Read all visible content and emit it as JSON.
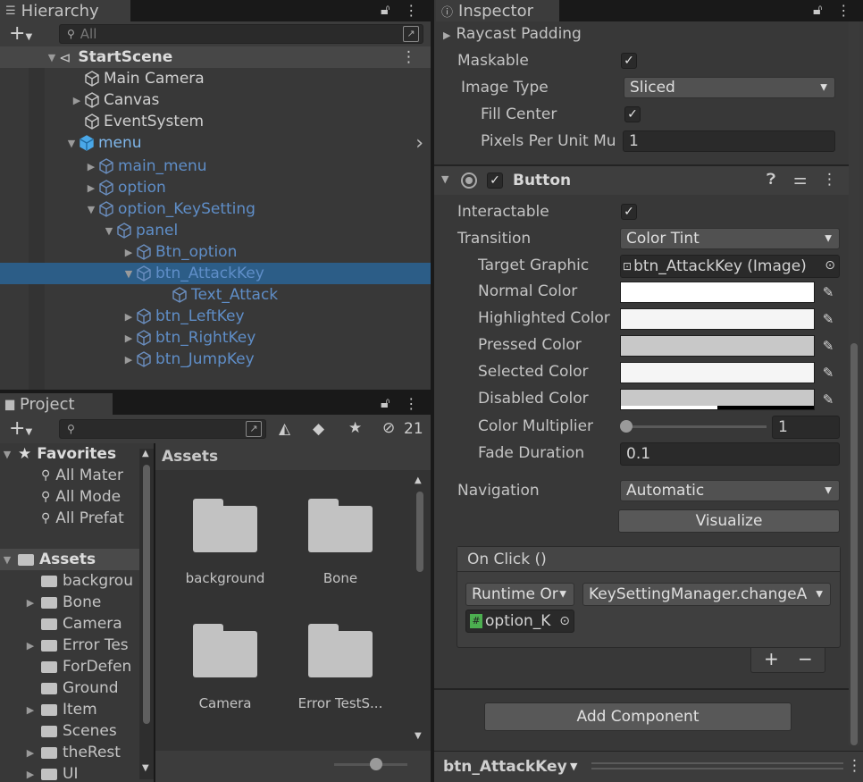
{
  "hierarchy": {
    "tab_label": "Hierarchy",
    "search_placeholder": "All",
    "scene_name": "StartScene",
    "items": [
      {
        "label": "Main Camera"
      },
      {
        "label": "Canvas"
      },
      {
        "label": "EventSystem"
      },
      {
        "label": "menu"
      },
      {
        "label": "main_menu"
      },
      {
        "label": "option"
      },
      {
        "label": "option_KeySetting"
      },
      {
        "label": "panel"
      },
      {
        "label": "Btn_option"
      },
      {
        "label": "btn_AttackKey"
      },
      {
        "label": "Text_Attack"
      },
      {
        "label": "btn_LeftKey"
      },
      {
        "label": "btn_RightKey"
      },
      {
        "label": "btn_JumpKey"
      }
    ]
  },
  "project": {
    "tab_label": "Project",
    "hidden_count": "21",
    "favorites_label": "Favorites",
    "favorites": [
      "All Mater",
      "All Mode",
      "All Prefat"
    ],
    "assets_label": "Assets",
    "assets_tree": [
      "backgrou",
      "Bone",
      "Camera",
      "Error Tes",
      "ForDefen",
      "Ground",
      "Item",
      "Scenes",
      "theRest",
      "UI"
    ],
    "breadcrumb": "Assets",
    "grid": [
      "background",
      "Bone",
      "Camera",
      "Error TestS..."
    ]
  },
  "inspector": {
    "tab_label": "Inspector",
    "image": {
      "raycast_padding": "Raycast Padding",
      "maskable": "Maskable",
      "image_type_label": "Image Type",
      "image_type_value": "Sliced",
      "fill_center": "Fill Center",
      "ppu_label": "Pixels Per Unit Mu",
      "ppu_value": "1"
    },
    "button": {
      "title": "Button",
      "interactable": "Interactable",
      "transition_label": "Transition",
      "transition_value": "Color Tint",
      "target_graphic_label": "Target Graphic",
      "target_graphic_value": "btn_AttackKey (Image)",
      "normal_color": "Normal Color",
      "highlighted_color": "Highlighted Color",
      "pressed_color": "Pressed Color",
      "selected_color": "Selected Color",
      "disabled_color": "Disabled Color",
      "color_multiplier_label": "Color Multiplier",
      "color_multiplier_value": "1",
      "fade_duration_label": "Fade Duration",
      "fade_duration_value": "0.1",
      "navigation_label": "Navigation",
      "navigation_value": "Automatic",
      "visualize": "Visualize",
      "onclick_title": "On Click ()",
      "runtime_value": "Runtime Or",
      "function_value": "KeySettingManager.changeA",
      "object_value": "option_K",
      "plus": "+",
      "minus": "−"
    },
    "add_component": "Add Component",
    "footer_object": "btn_AttackKey"
  },
  "colors": {
    "selection": "#2c5d87",
    "prefab_blue": "#5f8ec8",
    "normal_color": "#ffffff",
    "highlighted_color": "#f5f5f5",
    "pressed_color": "#c8c8c8",
    "selected_color": "#f5f5f5",
    "disabled_color": "#c8c8c8"
  }
}
